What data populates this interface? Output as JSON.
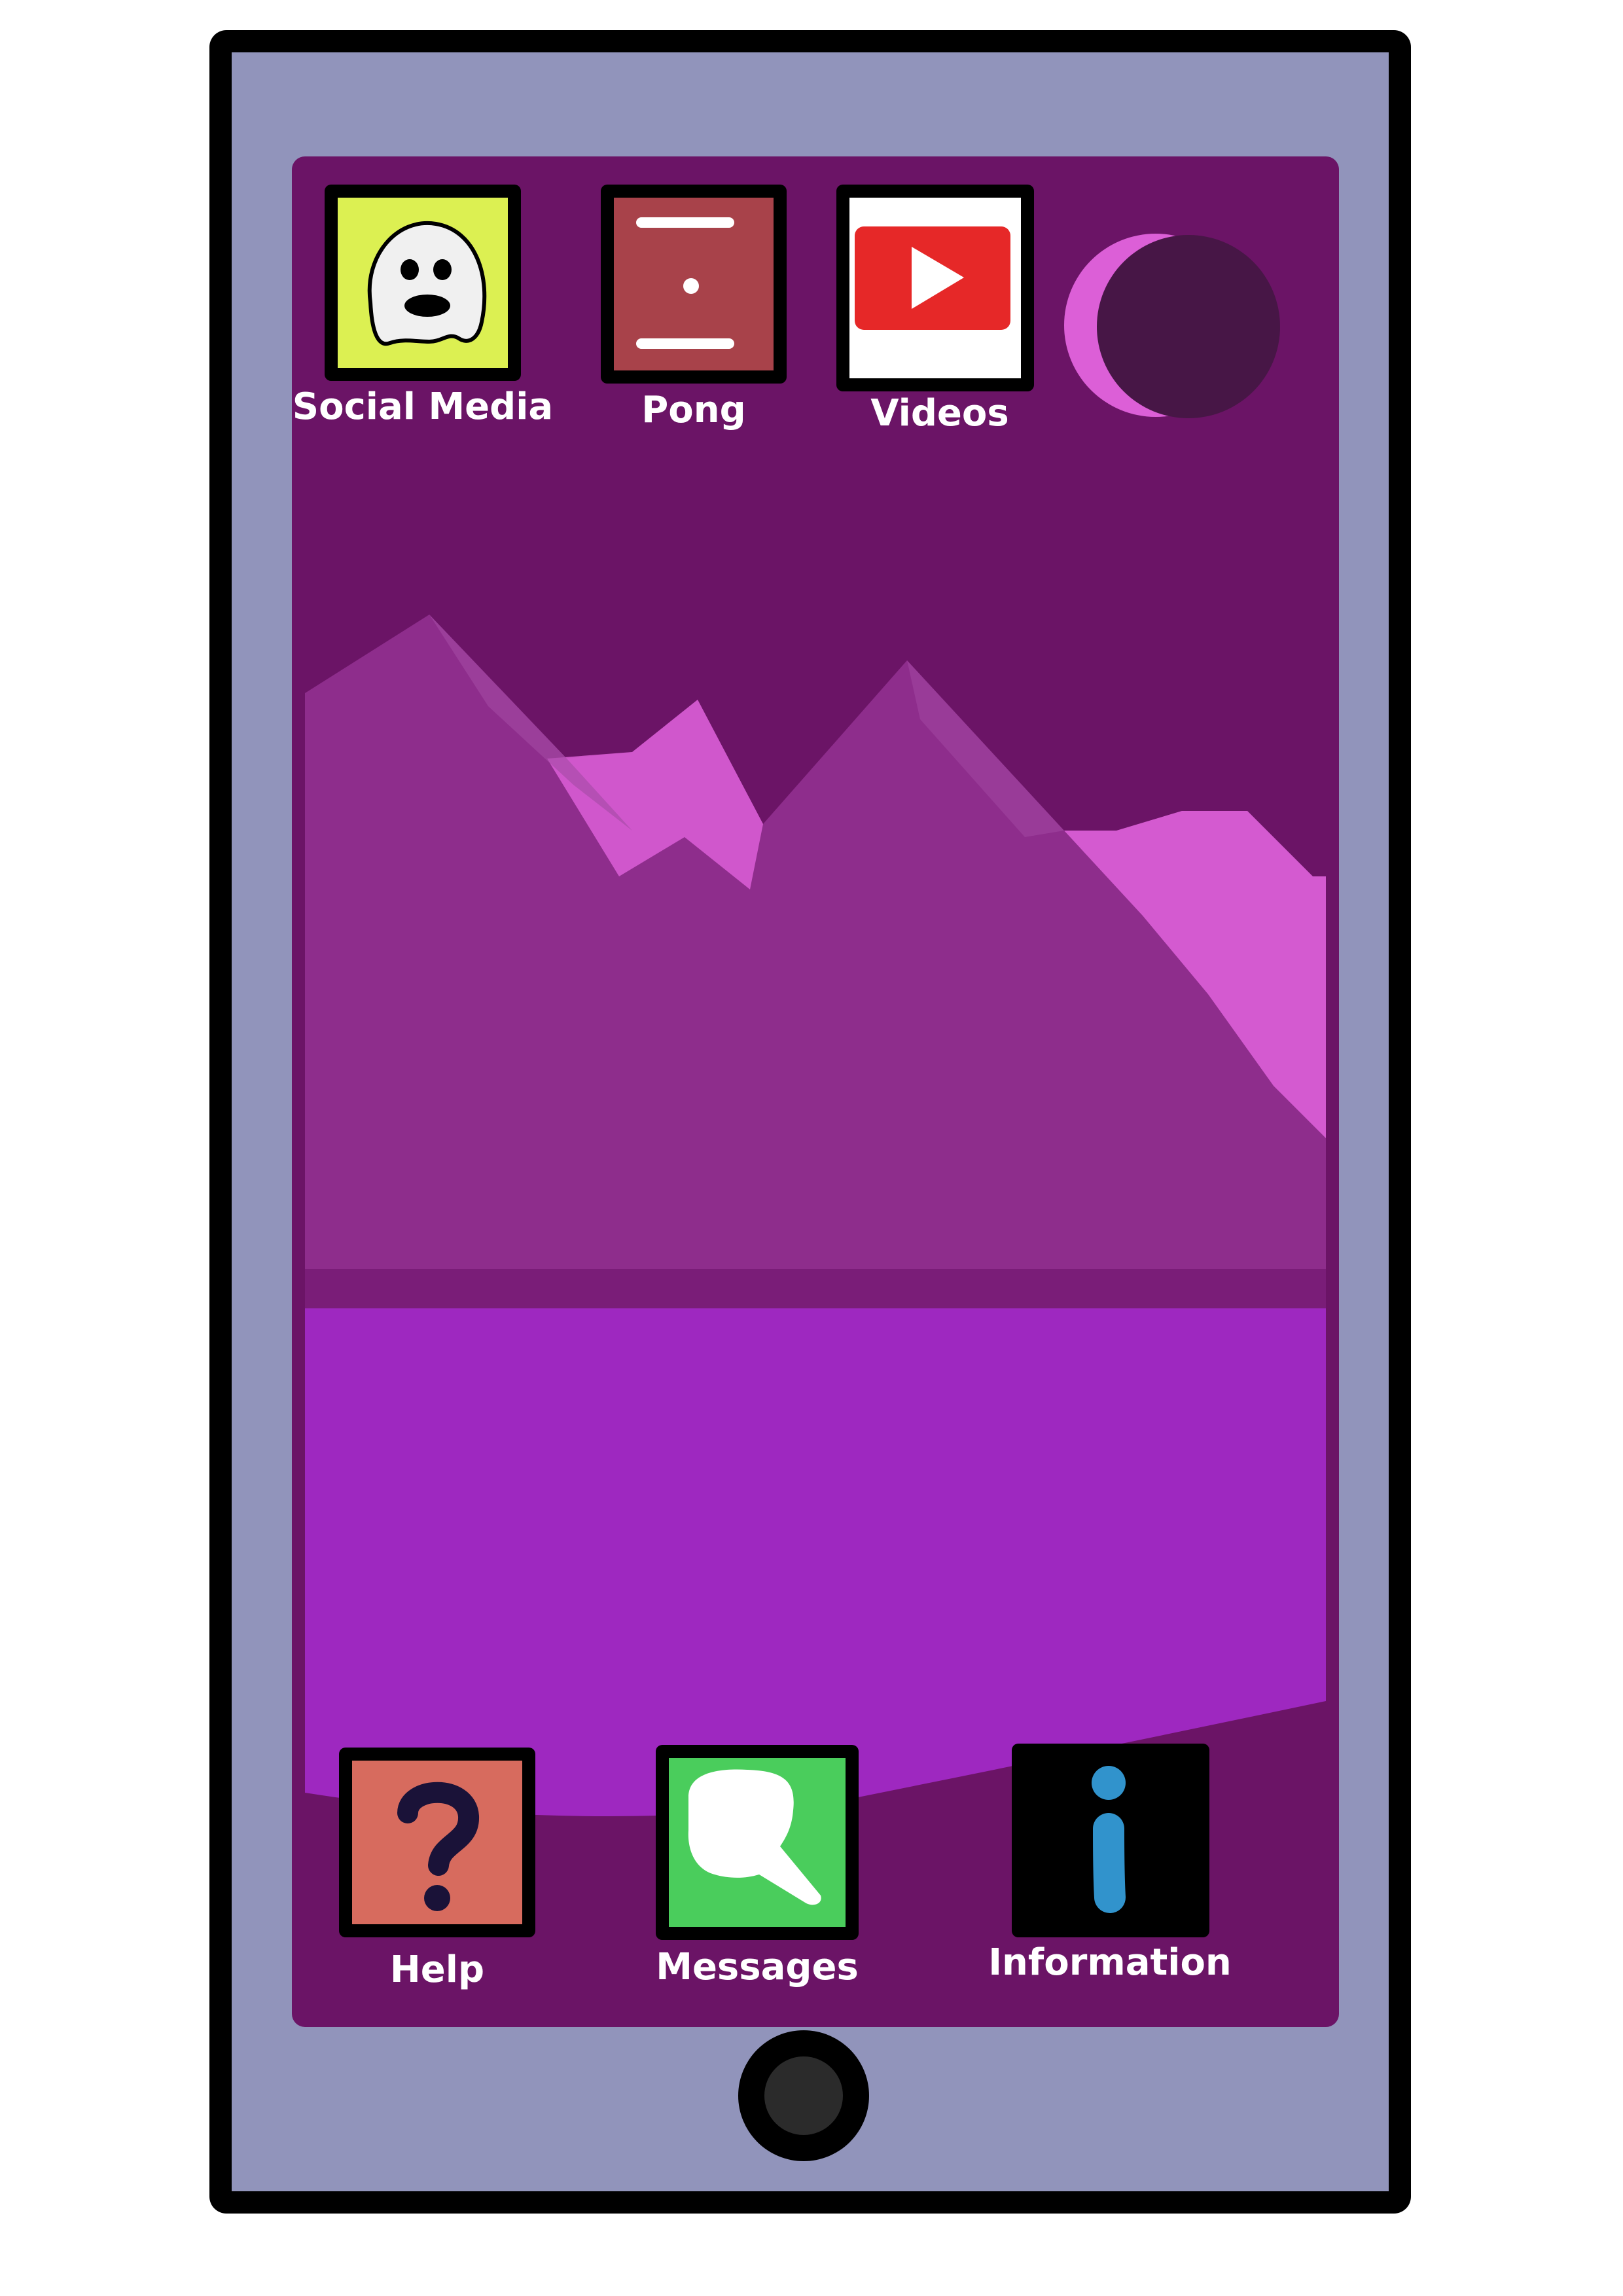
{
  "colors": {
    "frame": "#000000",
    "bezel": "#9194bb",
    "screen": "#6b1466",
    "mountain": "#8e2d8c",
    "mountain_highlight": "#dc5fd7",
    "lake": "#9e28c0",
    "label": "#ffffff"
  },
  "top_apps": [
    {
      "label": "Social Media",
      "icon": "ghost-icon",
      "tile_color": "#dcf052"
    },
    {
      "label": "Pong",
      "icon": "pong-icon",
      "tile_color": "#a8424a"
    },
    {
      "label": "Videos",
      "icon": "play-video-icon",
      "tile_color": "#ffffff"
    }
  ],
  "bottom_apps": [
    {
      "label": "Help",
      "icon": "question-mark-icon",
      "tile_color": "#d76b5e"
    },
    {
      "label": "Messages",
      "icon": "speech-bubble-icon",
      "tile_color": "#4acd5c"
    },
    {
      "label": "Information",
      "icon": "info-icon",
      "tile_color": "#000000"
    }
  ],
  "moon": {
    "icon": "crescent-moon-icon"
  },
  "home_button": {
    "icon": "home-button"
  }
}
